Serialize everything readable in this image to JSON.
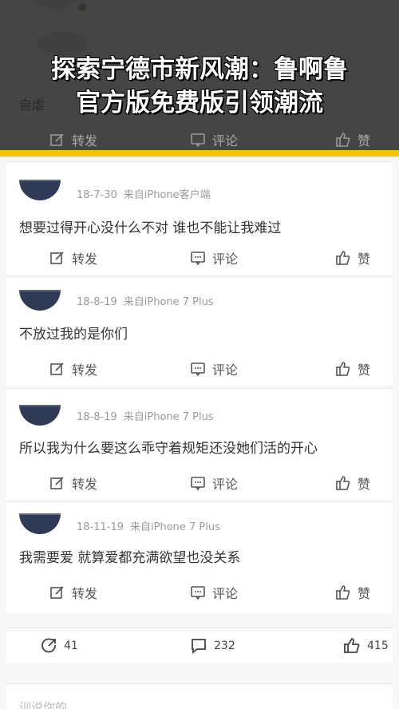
{
  "banner": {
    "title_line1": "探索宁德市新风潮：鲁啊鲁",
    "title_line2": "官方版免费版引领潮流"
  },
  "top_post": {
    "text_prefix": "自虐",
    "actions": {
      "repost": "转发",
      "comment": "评论",
      "like": "赞"
    }
  },
  "posts": [
    {
      "time": "18-7-30",
      "source": "来自iPhone客户端",
      "text": "想要过得开心没什么不对 谁也不能让我难过",
      "actions": {
        "repost": "转发",
        "comment": "评论",
        "like": "赞"
      }
    },
    {
      "time": "18-8-19",
      "source": "来自iPhone 7 Plus",
      "text": "不放过我的是你们",
      "actions": {
        "repost": "转发",
        "comment": "评论",
        "like": "赞"
      }
    },
    {
      "time": "18-8-19",
      "source": "来自iPhone 7 Plus",
      "text": "所以我为什么要这么乖守着规矩还没她们活的开心",
      "actions": {
        "repost": "转发",
        "comment": "评论",
        "like": "赞"
      }
    },
    {
      "time": "18-11-19",
      "source": "来自iPhone 7 Plus",
      "text": "我需要爱 就算爱都充满欲望也没关系",
      "actions": {
        "repost": "转发",
        "comment": "评论",
        "like": "赞"
      }
    }
  ],
  "stats": {
    "reposts": "41",
    "comments": "232",
    "likes": "415"
  },
  "next_post_partial": "训说你的..."
}
